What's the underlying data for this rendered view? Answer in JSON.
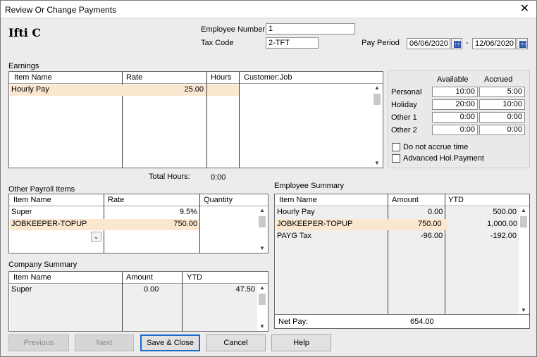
{
  "window": {
    "title": "Review Or Change Payments",
    "close": "✕"
  },
  "employee": {
    "name": "Ifti C",
    "number_label": "Employee Number",
    "number": "1",
    "tax_code_label": "Tax Code",
    "tax_code": "2-TFT",
    "pay_period_label": "Pay Period",
    "period_from": "06/06/2020",
    "period_sep": "-",
    "period_to": "12/06/2020"
  },
  "earnings": {
    "label": "Earnings",
    "headers": [
      "Item Name",
      "Rate",
      "Hours",
      "Customer:Job"
    ],
    "rows": [
      {
        "item": "Hourly Pay",
        "rate": "25.00",
        "hours": "",
        "job": ""
      }
    ],
    "total_hours_label": "Total Hours:",
    "total_hours": "0:00"
  },
  "accruals": {
    "headers": [
      "Available",
      "Accrued"
    ],
    "rows": [
      {
        "name": "Personal",
        "available": "10:00",
        "accrued": "5:00"
      },
      {
        "name": "Holiday",
        "available": "20:00",
        "accrued": "10:00"
      },
      {
        "name": "Other 1",
        "available": "0:00",
        "accrued": "0:00"
      },
      {
        "name": "Other 2",
        "available": "0:00",
        "accrued": "0:00"
      }
    ],
    "do_not_accrue_label": "Do not accrue time",
    "advanced_hol_label": "Advanced Hol.Payment"
  },
  "other_payroll": {
    "label": "Other Payroll Items",
    "headers": [
      "Item Name",
      "Rate",
      "Quantity"
    ],
    "rows": [
      {
        "item": "Super",
        "rate": "9.5%",
        "qty": ""
      },
      {
        "item": "JOBKEEPER-TOPUP",
        "rate": "750.00",
        "qty": ""
      }
    ]
  },
  "company_summary": {
    "label": "Company Summary",
    "headers": [
      "Item Name",
      "Amount",
      "YTD"
    ],
    "rows": [
      {
        "item": "Super",
        "amount": "0.00",
        "ytd": "47.50"
      }
    ]
  },
  "employee_summary": {
    "label": "Employee Summary",
    "headers": [
      "Item Name",
      "Amount",
      "YTD"
    ],
    "rows": [
      {
        "item": "Hourly Pay",
        "amount": "0.00",
        "ytd": "500.00"
      },
      {
        "item": "JOBKEEPER-TOPUP",
        "amount": "750.00",
        "ytd": "1,000.00"
      },
      {
        "item": "PAYG Tax",
        "amount": "-96.00",
        "ytd": "-192.00"
      }
    ],
    "net_pay_label": "Net Pay:",
    "net_pay": "654.00"
  },
  "buttons": {
    "previous": "Previous",
    "next": "Next",
    "save_close": "Save & Close",
    "cancel": "Cancel",
    "help": "Help"
  }
}
